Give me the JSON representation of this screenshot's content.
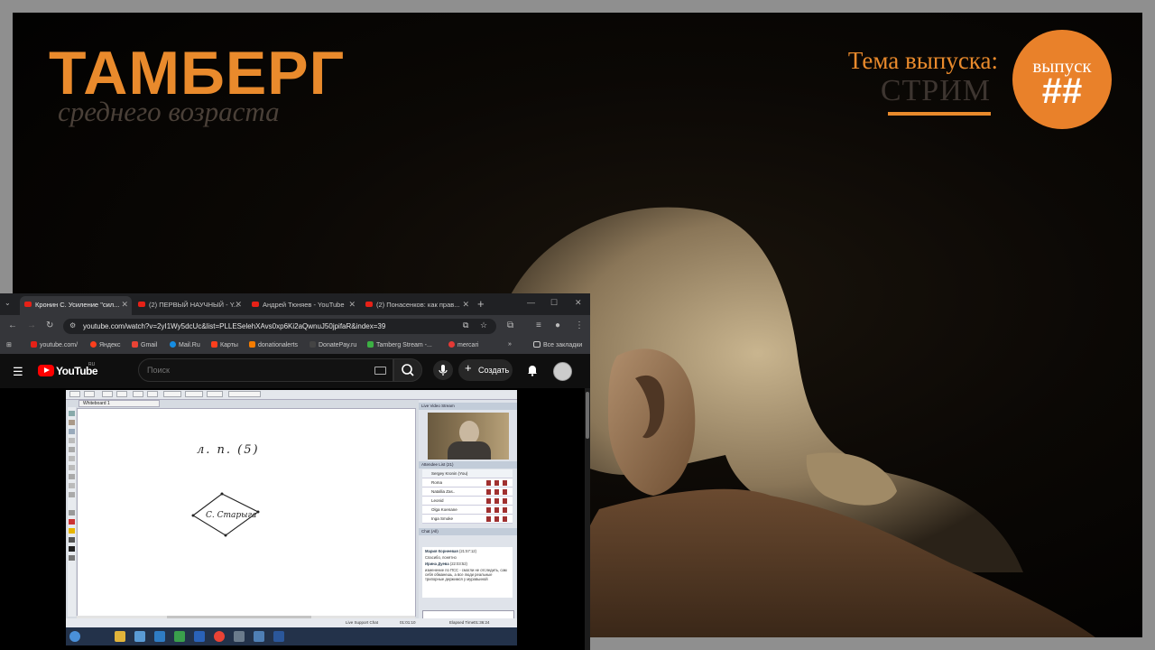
{
  "overlay": {
    "brand_title": "ТАМБЕРГ",
    "brand_subtitle": "среднего возраста",
    "topic_label": "Тема выпуска:",
    "topic_value": "СТРИМ",
    "episode_label": "выпуск",
    "episode_number": "##",
    "accent_color": "#e98a2c"
  },
  "browser": {
    "tabs": [
      {
        "label": "Кронин С. Усиление \"сил..."
      },
      {
        "label": "(2) ПЕРВЫЙ НАУЧНЫЙ - Y..."
      },
      {
        "label": "Андрей Тюняев - YouTube"
      },
      {
        "label": "(2) Понасенков: как прав..."
      }
    ],
    "url": "youtube.com/watch?v=2yI1Wy5dcUc&list=PLLESelehXAvs0xp6Ki2aQwnuJ50jpifaR&index=39",
    "bookmarks": [
      {
        "label": "youtube.com/",
        "icon": "youtube-icon",
        "color": "#e62117"
      },
      {
        "label": "Яндекс",
        "icon": "yandex-icon",
        "color": "#fc3f1d"
      },
      {
        "label": "Gmail",
        "icon": "gmail-icon",
        "color": "#ea4335"
      },
      {
        "label": "Mail.Ru",
        "icon": "mailru-icon",
        "color": "#168de2"
      },
      {
        "label": "Карты",
        "icon": "maps-icon",
        "color": "#fc3f1d"
      },
      {
        "label": "donationalerts",
        "icon": "donationalerts-icon",
        "color": "#f57c00"
      },
      {
        "label": "DonatePay.ru",
        "icon": "donatepay-icon",
        "color": "#2a2a2a"
      },
      {
        "label": "Tamberg Stream -...",
        "icon": "tamberg-icon",
        "color": "#3cb043"
      },
      {
        "label": "mercari",
        "icon": "mercari-icon",
        "color": "#e53935"
      }
    ],
    "all_bookmarks_label": "Все закладки"
  },
  "youtube": {
    "logo_text": "YouTube",
    "region": "RU",
    "search_placeholder": "Поиск",
    "create_label": "Создать"
  },
  "video": {
    "whiteboard_tab": "Whiteboard 1",
    "whiteboard_line1": "л. п. (5)",
    "whiteboard_line2": "С. Старыга",
    "webcam_header": "Live Video Stream",
    "attendees_header": "Attendee List (21)",
    "attendees": [
      "Sergey Kronin (You)",
      "Roma",
      "Natallia Zas..",
      "Leonid",
      "Olga Koenane",
      "Inga Smoke"
    ],
    "chat_header": "Chat (All)",
    "chat_messages": [
      {
        "name": "Мария Корнеевая",
        "time": "(21:57:12)",
        "text": "Спасибо, понятно"
      },
      {
        "name": "Ирина Дуева",
        "time": "(22:03:52)",
        "text": "изменение по ПСС - смогли не отследить, сам себя обманешь, а все люди реальные трипорные держимся у муравьиной"
      }
    ],
    "live_chat_label": "Live Support Chat",
    "elapsed": "01:01:10",
    "elapsed_label": "Elapsed Time",
    "elapsed_value": "01:36:24"
  }
}
